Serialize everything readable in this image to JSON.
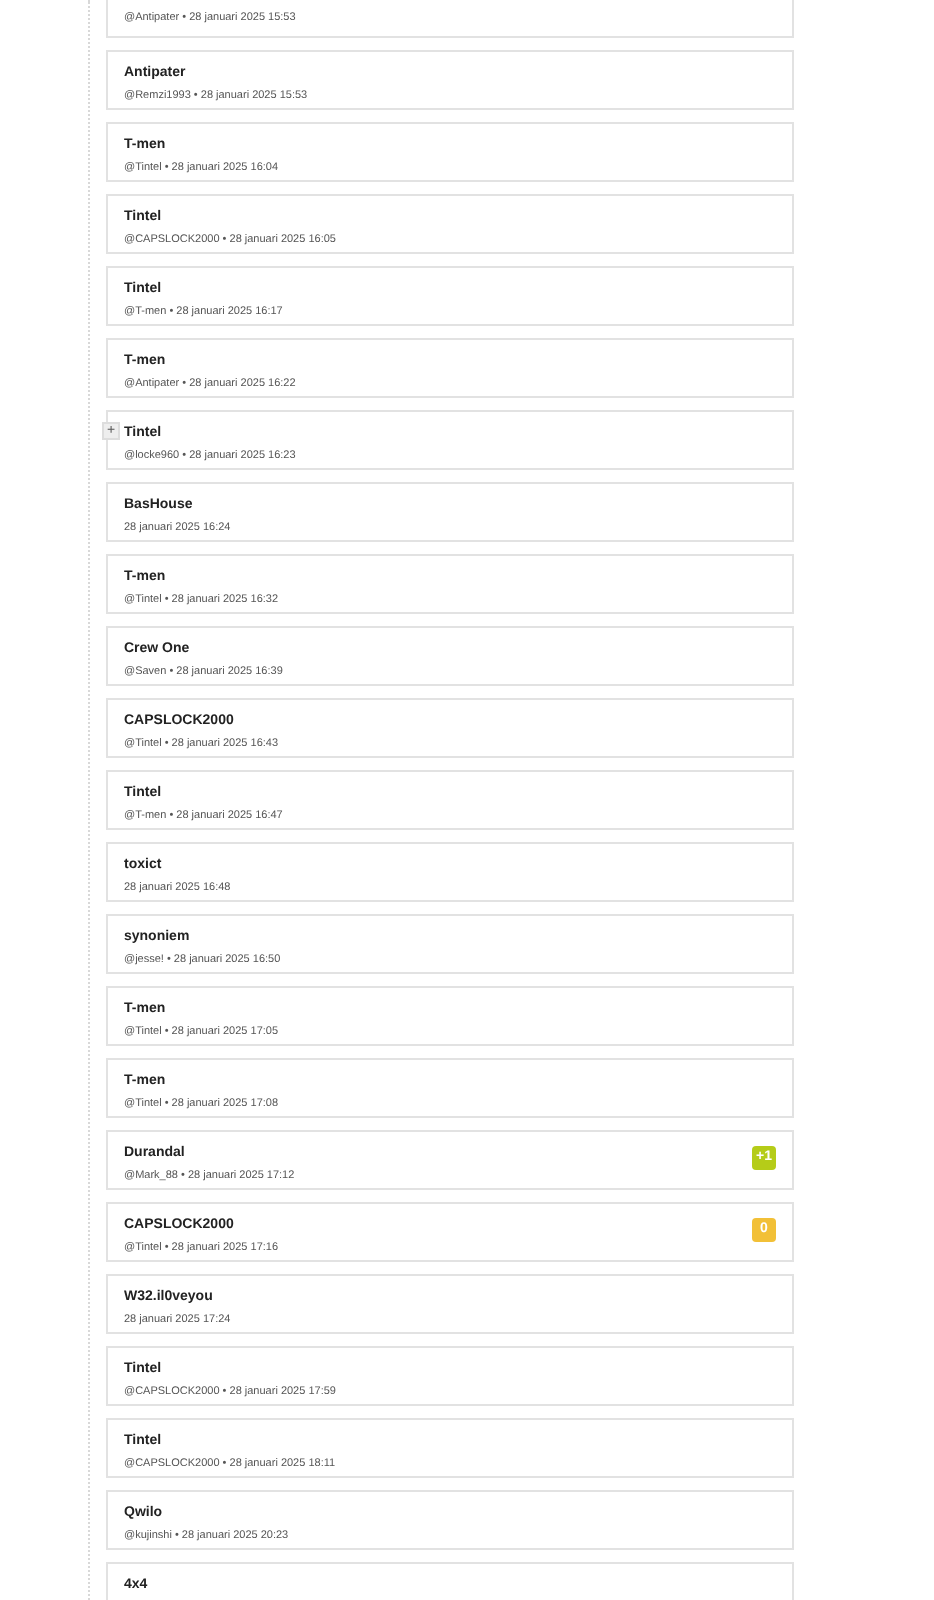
{
  "comments": [
    {
      "meta": "@Antipater • 28 januari 2025 15:53"
    },
    {
      "author": "Antipater",
      "meta": "@Remzi1993 • 28 januari 2025 15:53"
    },
    {
      "author": "T-men",
      "meta": "@Tintel • 28 januari 2025 16:04"
    },
    {
      "author": "Tintel",
      "meta": "@CAPSLOCK2000 • 28 januari 2025 16:05"
    },
    {
      "author": "Tintel",
      "meta": "@T-men • 28 januari 2025 16:17"
    },
    {
      "author": "T-men",
      "meta": "@Antipater • 28 januari 2025 16:22"
    },
    {
      "author": "Tintel",
      "meta": "@locke960 • 28 januari 2025 16:23",
      "expand_button": "+"
    },
    {
      "author": "BasHouse",
      "meta": "28 januari 2025 16:24"
    },
    {
      "author": "T-men",
      "meta": "@Tintel • 28 januari 2025 16:32"
    },
    {
      "author": "Crew One",
      "meta": "@Saven • 28 januari 2025 16:39"
    },
    {
      "author": "CAPSLOCK2000",
      "meta": "@Tintel • 28 januari 2025 16:43"
    },
    {
      "author": "Tintel",
      "meta": "@T-men • 28 januari 2025 16:47"
    },
    {
      "author": "toxict",
      "meta": "28 januari 2025 16:48"
    },
    {
      "author": "synoniem",
      "meta": "@jesse! • 28 januari 2025 16:50"
    },
    {
      "author": "T-men",
      "meta": "@Tintel • 28 januari 2025 17:05"
    },
    {
      "author": "T-men",
      "meta": "@Tintel • 28 januari 2025 17:08"
    },
    {
      "author": "Durandal",
      "meta": "@Mark_88 • 28 januari 2025 17:12",
      "score": {
        "text": "+1",
        "color": "#b5cc18"
      }
    },
    {
      "author": "CAPSLOCK2000",
      "meta": "@Tintel • 28 januari 2025 17:16",
      "score": {
        "text": "0",
        "color": "#f2c037"
      }
    },
    {
      "author": "W32.il0veyou",
      "meta": "28 januari 2025 17:24"
    },
    {
      "author": "Tintel",
      "meta": "@CAPSLOCK2000 • 28 januari 2025 17:59"
    },
    {
      "author": "Tintel",
      "meta": "@CAPSLOCK2000 • 28 januari 2025 18:11"
    },
    {
      "author": "Qwilo",
      "meta": "@kujinshi • 28 januari 2025 20:23"
    },
    {
      "author": "4x4"
    }
  ]
}
